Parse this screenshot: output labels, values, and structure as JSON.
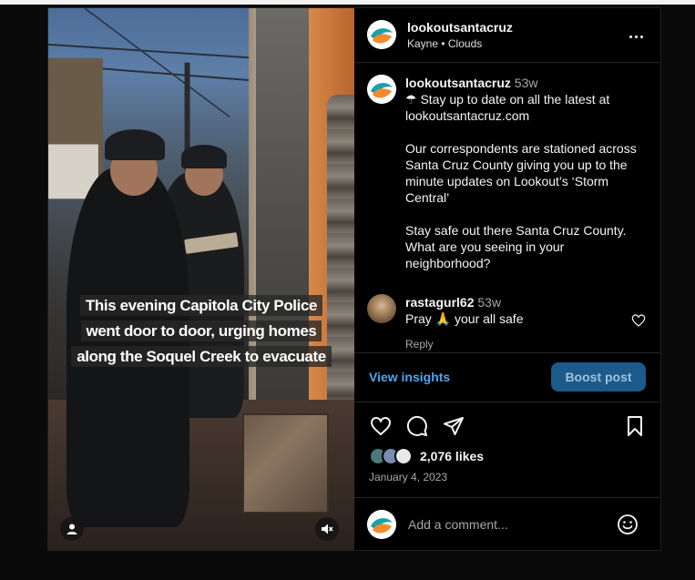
{
  "post": {
    "author": {
      "username": "lookoutsantacruz",
      "music": "Kayne • Clouds"
    },
    "media": {
      "caption_lines": [
        "This evening Capitola City Police",
        "went door to door, urging homes",
        "along the Soquel Creek to evacuate"
      ]
    },
    "description": {
      "username": "lookoutsantacruz",
      "time": "53w",
      "paragraphs": [
        "☂ Stay up to date on all the latest at lookoutsantacruz.com",
        "Our correspondents are stationed across Santa Cruz County giving you up to the minute updates on Lookout’s ‘Storm Central’",
        "Stay safe out there Santa Cruz County. What are you seeing in your neighborhood?"
      ]
    },
    "comment": {
      "username": "rastagurl62",
      "time": "53w",
      "text": "Pray 🙏 your all safe",
      "reply_label": "Reply"
    },
    "insights": {
      "view_label": "View insights",
      "boost_label": "Boost post"
    },
    "stats": {
      "likes": "2,076 likes",
      "date": "January 4, 2023"
    },
    "composer": {
      "placeholder": "Add a comment..."
    }
  },
  "colors": {
    "link_blue": "#4aa6f1",
    "boost_bg": "#1c5a8a",
    "brand_teal": "#1aa0a8",
    "brand_orange": "#f28a2e"
  },
  "icons": [
    "more-icon",
    "heart-icon",
    "comment-icon",
    "share-icon",
    "bookmark-icon",
    "emoji-icon",
    "user-tag-icon",
    "muted-icon"
  ]
}
